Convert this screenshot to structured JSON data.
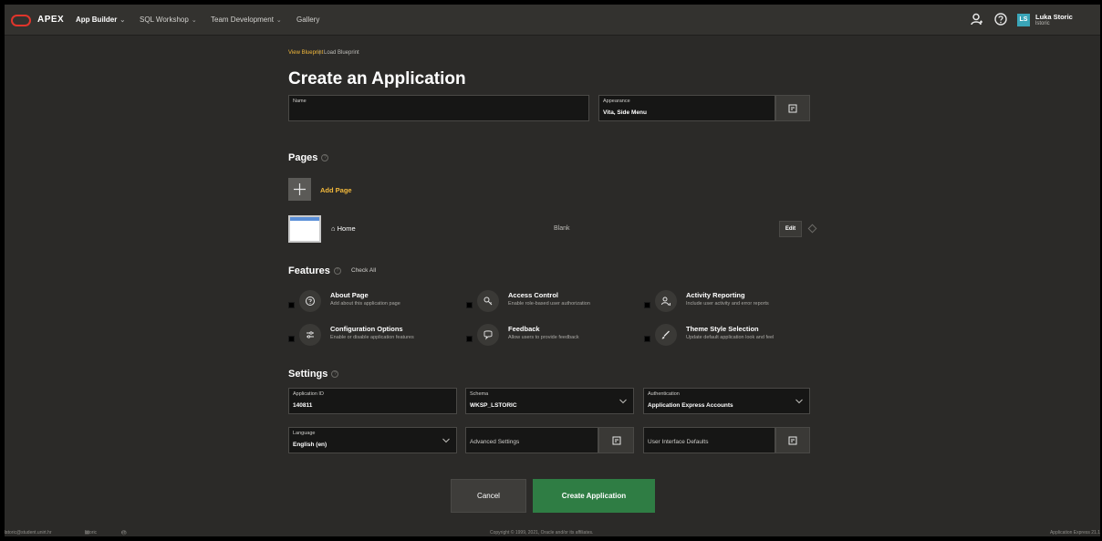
{
  "header": {
    "app_name": "APEX",
    "nav": [
      {
        "label": "App Builder",
        "chevron": true
      },
      {
        "label": "SQL Workshop",
        "chevron": true
      },
      {
        "label": "Team Development",
        "chevron": true
      },
      {
        "label": "Gallery",
        "chevron": false
      }
    ],
    "user": {
      "initials": "LS",
      "name": "Luka Storic",
      "username": "lstoric"
    },
    "icons": [
      "user-icon",
      "help-icon"
    ]
  },
  "breadcrumb": {
    "link": "View Blueprint",
    "separator": "|",
    "current": "Load Blueprint"
  },
  "title": "Create an Application",
  "name_field": {
    "label": "Name",
    "value": ""
  },
  "appearance_field": {
    "label": "Appearance",
    "value": "Vita, Side Menu"
  },
  "pages": {
    "heading": "Pages",
    "add_label": "Add Page",
    "items": [
      {
        "name": "Home",
        "type": "Blank",
        "edit_label": "Edit"
      }
    ]
  },
  "features": {
    "heading": "Features",
    "check_all": "Check All",
    "items": [
      {
        "title": "About Page",
        "desc": "Add about this application page",
        "icon": "help-circle-icon"
      },
      {
        "title": "Access Control",
        "desc": "Enable role-based user authorization",
        "icon": "key-icon"
      },
      {
        "title": "Activity Reporting",
        "desc": "Include user activity and error reports",
        "icon": "user-chart-icon"
      },
      {
        "title": "Configuration Options",
        "desc": "Enable or disable application features",
        "icon": "sliders-icon"
      },
      {
        "title": "Feedback",
        "desc": "Allow users to provide feedback",
        "icon": "speech-bubble-icon"
      },
      {
        "title": "Theme Style Selection",
        "desc": "Update default application look and feel",
        "icon": "brush-icon"
      }
    ]
  },
  "settings": {
    "heading": "Settings",
    "application_id": {
      "label": "Application ID",
      "value": "140811"
    },
    "schema": {
      "label": "Schema",
      "value": "WKSP_LSTORIC"
    },
    "authentication": {
      "label": "Authentication",
      "value": "Application Express Accounts"
    },
    "language": {
      "label": "Language",
      "value": "English (en)"
    },
    "advanced": {
      "label": "Advanced Settings"
    },
    "ui_defaults": {
      "label": "User Interface Defaults"
    }
  },
  "buttons": {
    "cancel": "Cancel",
    "create": "Create Application"
  },
  "footer": {
    "email": "lstoric@student.unirt.hr",
    "workspace": "lstoric",
    "language": "en",
    "copyright": "Copyright © 1999, 2021, Oracle and/or its affiliates.",
    "version": "Application Express 21.1"
  },
  "colors": {
    "accent": "#f3b93b",
    "create_button": "#2f7d44",
    "logo": "#e0352b",
    "avatar": "#3aa5b8"
  }
}
